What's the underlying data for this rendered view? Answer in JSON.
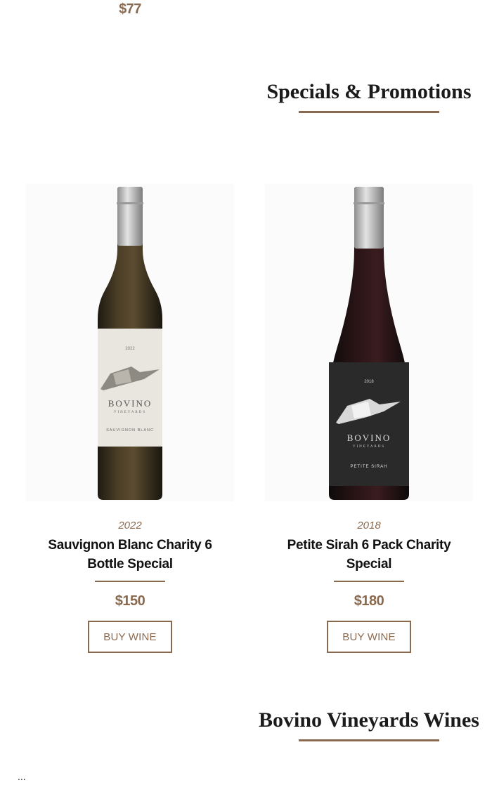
{
  "previous_item": {
    "price": "$77"
  },
  "specials": {
    "title": "Specials & Promotions",
    "products": [
      {
        "vintage": "2022",
        "name": "Sauvignon Blanc Charity 6 Bottle Special",
        "price": "$150",
        "button": "BUY WINE",
        "label": {
          "year": "2022",
          "brand": "BOVINO",
          "sub": "VINEYARDS",
          "varietal": "SAUVIGNON BLANC"
        }
      },
      {
        "vintage": "2018",
        "name": "Petite Sirah 6 Pack Charity Special",
        "price": "$180",
        "button": "BUY WINE",
        "label": {
          "year": "2018",
          "brand": "BOVINO",
          "sub": "VINEYARDS",
          "varietal": "PETITE SIRAH"
        }
      }
    ]
  },
  "wines_section": {
    "title": "Bovino Vineyards Wines"
  },
  "footer": {
    "ellipsis": "..."
  },
  "colors": {
    "accent": "#8a6a4f",
    "white_label": "#e9e6e0",
    "black_label": "#2a2a2a",
    "capsule": "#c9c9c9"
  }
}
